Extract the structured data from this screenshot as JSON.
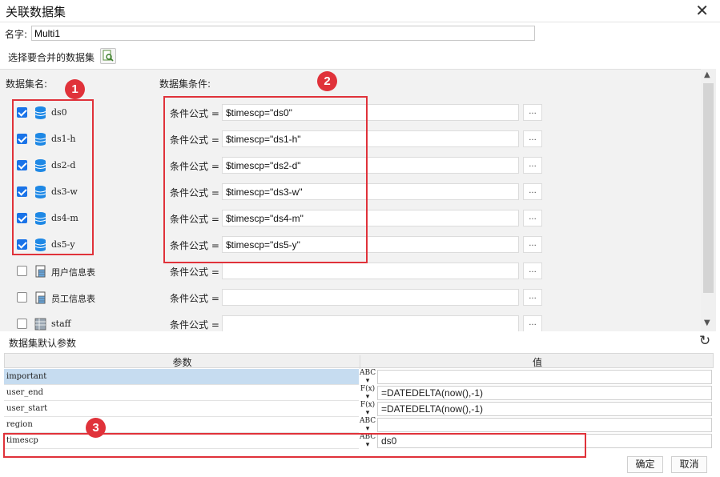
{
  "window": {
    "title": "关联数据集",
    "close_glyph": "✕"
  },
  "name_field": {
    "label": "名字:",
    "value": "Multi1"
  },
  "merge": {
    "label": "选择要合并的数据集"
  },
  "datasets_panel": {
    "col_name_header": "数据集名:",
    "col_cond_header": "数据集条件:",
    "rows": [
      {
        "checked": true,
        "name": "ds0",
        "icon": "database-icon",
        "cond_label": "条件公式 =",
        "cond_value": "$timescp=\"ds0\"",
        "dots": "..."
      },
      {
        "checked": true,
        "name": "ds1-h",
        "icon": "database-icon",
        "cond_label": "条件公式 =",
        "cond_value": "$timescp=\"ds1-h\"",
        "dots": "..."
      },
      {
        "checked": true,
        "name": "ds2-d",
        "icon": "database-icon",
        "cond_label": "条件公式 =",
        "cond_value": "$timescp=\"ds2-d\"",
        "dots": "..."
      },
      {
        "checked": true,
        "name": "ds3-w",
        "icon": "database-icon",
        "cond_label": "条件公式 =",
        "cond_value": "$timescp=\"ds3-w\"",
        "dots": "..."
      },
      {
        "checked": true,
        "name": "ds4-m",
        "icon": "database-icon",
        "cond_label": "条件公式 =",
        "cond_value": "$timescp=\"ds4-m\"",
        "dots": "..."
      },
      {
        "checked": true,
        "name": "ds5-y",
        "icon": "database-icon",
        "cond_label": "条件公式 =",
        "cond_value": "$timescp=\"ds5-y\"",
        "dots": "..."
      },
      {
        "checked": false,
        "name": "用户信息表",
        "icon": "table-icon",
        "cond_label": "条件公式 =",
        "cond_value": "",
        "dots": "..."
      },
      {
        "checked": false,
        "name": "员工信息表",
        "icon": "table-icon",
        "cond_label": "条件公式 =",
        "cond_value": "",
        "dots": "..."
      },
      {
        "checked": false,
        "name": "staff",
        "icon": "server-table-icon",
        "cond_label": "条件公式 =",
        "cond_value": "",
        "dots": "..."
      }
    ]
  },
  "params": {
    "section_label": "数据集默认参数",
    "col_param": "参数",
    "col_value": "值",
    "rows": [
      {
        "name": "important",
        "type": "ABC",
        "value": "",
        "selected": true
      },
      {
        "name": "user_end",
        "type": "F(x)",
        "value": "=DATEDELTA(now(),-1)",
        "selected": false
      },
      {
        "name": "user_start",
        "type": "F(x)",
        "value": "=DATEDELTA(now(),-1)",
        "selected": false
      },
      {
        "name": "region",
        "type": "ABC",
        "value": "",
        "selected": false
      },
      {
        "name": "timescp",
        "type": "ABC",
        "value": "ds0",
        "selected": false
      }
    ]
  },
  "footer": {
    "ok_label": "确定",
    "cancel_label": "取消"
  },
  "annotations": {
    "badge1": "1",
    "badge2": "2",
    "badge3": "3",
    "color": "#e0323a"
  },
  "colors": {
    "checkbox_blue": "#1a73e8",
    "selected_row": "#c6dcf0"
  }
}
